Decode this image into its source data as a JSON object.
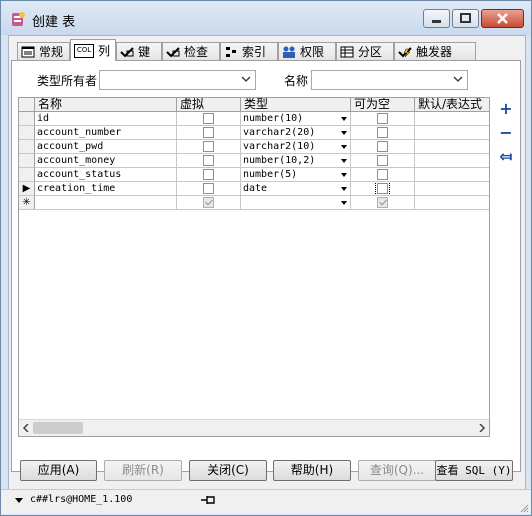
{
  "window": {
    "title": "创建 表"
  },
  "tabs": [
    {
      "icon": "general-tab-icon",
      "label": "常规",
      "active": false
    },
    {
      "icon": "columns-tab-icon",
      "icon_text": "COL",
      "label": "列",
      "active": true
    },
    {
      "icon": "keys-tab-icon",
      "label": "键",
      "active": false
    },
    {
      "icon": "checks-tab-icon",
      "label": "检查",
      "active": false
    },
    {
      "icon": "indexes-tab-icon",
      "label": "索引",
      "active": false
    },
    {
      "icon": "privileges-tab-icon",
      "label": "权限",
      "active": false
    },
    {
      "icon": "partitions-tab-icon",
      "label": "分区",
      "active": false
    },
    {
      "icon": "triggers-tab-icon",
      "label": "触发器",
      "active": false
    }
  ],
  "type_owner": {
    "label": "类型所有者",
    "value": ""
  },
  "name": {
    "label": "名称",
    "value": ""
  },
  "grid": {
    "headers": [
      "名称",
      "虚拟",
      "类型",
      "可为空",
      "默认/表达式"
    ],
    "rows": [
      {
        "name": "id",
        "virtual": false,
        "type": "number(10)",
        "nullable": false,
        "default": "",
        "current": false
      },
      {
        "name": "account_number",
        "virtual": false,
        "type": "varchar2(20)",
        "nullable": false,
        "default": "",
        "current": false
      },
      {
        "name": "account_pwd",
        "virtual": false,
        "type": "varchar2(10)",
        "nullable": false,
        "default": "",
        "current": false
      },
      {
        "name": "account_money",
        "virtual": false,
        "type": "number(10,2)",
        "nullable": false,
        "default": "",
        "current": false
      },
      {
        "name": "account_status",
        "virtual": false,
        "type": "number(5)",
        "nullable": false,
        "default": "",
        "current": false
      },
      {
        "name": "creation_time",
        "virtual": false,
        "type": "date",
        "nullable": false,
        "default": "",
        "current": true
      }
    ],
    "new_row": {
      "marker": "✳",
      "virtual": true,
      "nullable": true
    },
    "current_marker": "▶"
  },
  "side_buttons": [
    {
      "icon": "add-column-icon",
      "glyph": "+"
    },
    {
      "icon": "remove-column-icon",
      "glyph": "−"
    },
    {
      "icon": "insert-column-icon",
      "glyph": "⤆"
    }
  ],
  "buttons": {
    "apply": "应用(A)",
    "refresh": "刷新(R)",
    "close": "关闭(C)",
    "help": "帮助(H)",
    "query": "查询(Q)...",
    "view_sql": "查看 SQL (Y)"
  },
  "status": {
    "connection": "c##lrs@HOME_1.100"
  }
}
